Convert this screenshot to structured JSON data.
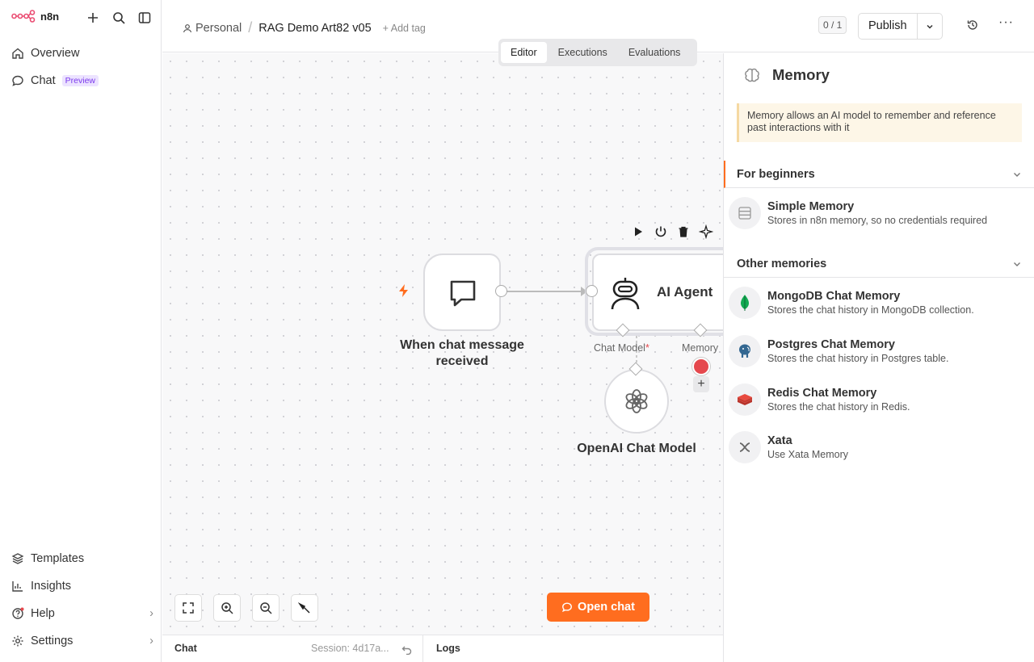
{
  "brand": {
    "name": "n8n"
  },
  "sidebar": {
    "top": [
      {
        "label": "Overview",
        "icon": "home-icon"
      },
      {
        "label": "Chat",
        "badge": "Preview",
        "icon": "chat-bubble-icon"
      }
    ],
    "bottom": [
      {
        "label": "Templates",
        "icon": "layers-icon"
      },
      {
        "label": "Insights",
        "icon": "bar-chart-icon"
      },
      {
        "label": "Help",
        "icon": "help-circle-icon"
      },
      {
        "label": "Settings",
        "icon": "gear-icon"
      }
    ]
  },
  "header": {
    "project": "Personal",
    "workflow": "RAG Demo Art82 v05",
    "add_tag": "+ Add tag",
    "counter": "0 / 1",
    "publish": "Publish"
  },
  "tabs": [
    "Editor",
    "Executions",
    "Evaluations"
  ],
  "canvas": {
    "trigger_label_line1": "When chat message",
    "trigger_label_line2": "received",
    "agent_title": "AI Agent",
    "port_chat_model": "Chat Model",
    "port_required": "*",
    "port_memory": "Memory",
    "model_label": "OpenAI Chat Model",
    "open_chat": "Open chat"
  },
  "bottombar": {
    "chat": "Chat",
    "session": "Session: 4d17a...",
    "logs": "Logs"
  },
  "panel": {
    "title": "Memory",
    "notice": "Memory allows an AI model to remember and reference past interactions with it",
    "section1": "For beginners",
    "section2": "Other memories",
    "beginners": [
      {
        "title": "Simple Memory",
        "desc": "Stores in n8n memory, so no credentials required"
      }
    ],
    "others": [
      {
        "title": "MongoDB Chat Memory",
        "desc": "Stores the chat history in MongoDB collection."
      },
      {
        "title": "Postgres Chat Memory",
        "desc": "Stores the chat history in Postgres table."
      },
      {
        "title": "Redis Chat Memory",
        "desc": "Stores the chat history in Redis."
      },
      {
        "title": "Xata",
        "desc": "Use Xata Memory"
      }
    ]
  },
  "colors": {
    "accent": "#ff6d1f",
    "brand": "#ea4b71",
    "error": "#e5484d"
  }
}
